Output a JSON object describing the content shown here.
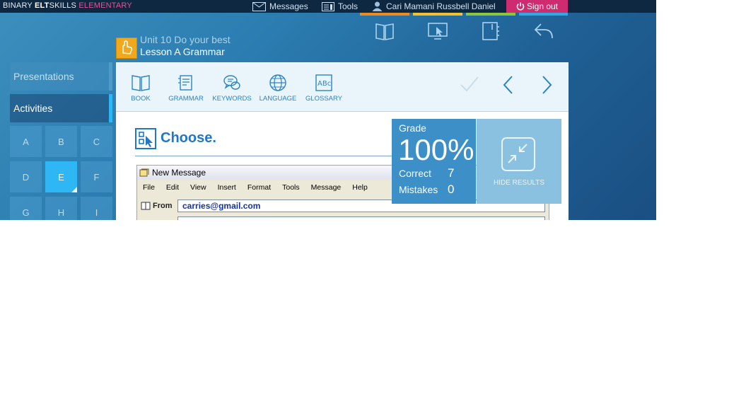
{
  "brand": {
    "part1": "BINARY ",
    "part2": "ELT",
    "part3": "SKILLS ",
    "part4": "ELEMENTARY"
  },
  "topbar": {
    "messages": "Messages",
    "tools": "Tools",
    "user": "Cari Mamani Russbell Daniel",
    "signout": "Sign out",
    "stripe_colors": [
      "#f08a1f",
      "#f2c12e",
      "#8cc63f",
      "#2fa8e6"
    ]
  },
  "header_icons": [
    "book-icon",
    "whiteboard-icon",
    "notebook-icon",
    "back-arrow-icon"
  ],
  "breadcrumb": {
    "unit": "Unit 10 Do your best",
    "lesson": "Lesson A Grammar"
  },
  "sidebar": {
    "presentations": "Presentations",
    "activities": "Activities",
    "activity_items": [
      "A",
      "B",
      "C",
      "D",
      "E",
      "F",
      "G",
      "H",
      "I"
    ],
    "selected": "E"
  },
  "toolbar": {
    "tools": [
      {
        "label": "BOOK",
        "icon": "book-icon"
      },
      {
        "label": "GRAMMAR",
        "icon": "grammar-icon"
      },
      {
        "label": "KEYWORDS",
        "icon": "keywords-icon"
      },
      {
        "label": "LANGUAGE",
        "icon": "language-globe-icon"
      },
      {
        "label": "GLOSSARY",
        "icon": "glossary-icon"
      }
    ]
  },
  "activity": {
    "title": "Choose.",
    "window_title": "New Message",
    "menu": [
      "File",
      "Edit",
      "View",
      "Insert",
      "Format",
      "Tools",
      "Message",
      "Help"
    ],
    "from_label": "From",
    "from_value": "carries@gmail.com"
  },
  "results": {
    "grade_label": "Grade",
    "grade_value": "100%",
    "correct_label": "Correct",
    "correct_value": "7",
    "mistakes_label": "Mistakes",
    "mistakes_value": "0",
    "hide_label": "HIDE RESULTS"
  },
  "colors": {
    "accent": "#2fb7f5",
    "signout": "#cf2b71",
    "grade_bg": "#3d8fc8",
    "hide_bg": "#8ac0e0",
    "badge": "#f2a81d"
  }
}
